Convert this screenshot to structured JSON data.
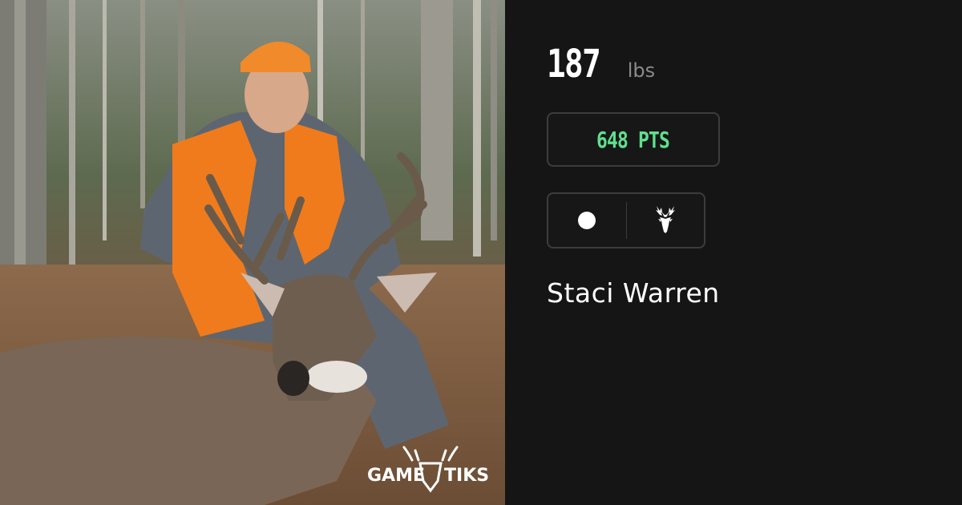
{
  "photo": {
    "description_icon": "deer-harvest-photo",
    "watermark_text": "GAME TIKS"
  },
  "stats": {
    "weight_value": "187",
    "weight_unit": "lbs",
    "score": "648 PTS"
  },
  "badges": {
    "left_icon": "dot-icon",
    "right_icon": "deer-head-icon"
  },
  "hunter": {
    "name": "Staci Warren"
  },
  "colors": {
    "background": "#151515",
    "score_green": "#5fe08e",
    "border": "#3c3c3c",
    "unit_gray": "#8a8a8a",
    "hunter_orange": "#f07b1c"
  }
}
